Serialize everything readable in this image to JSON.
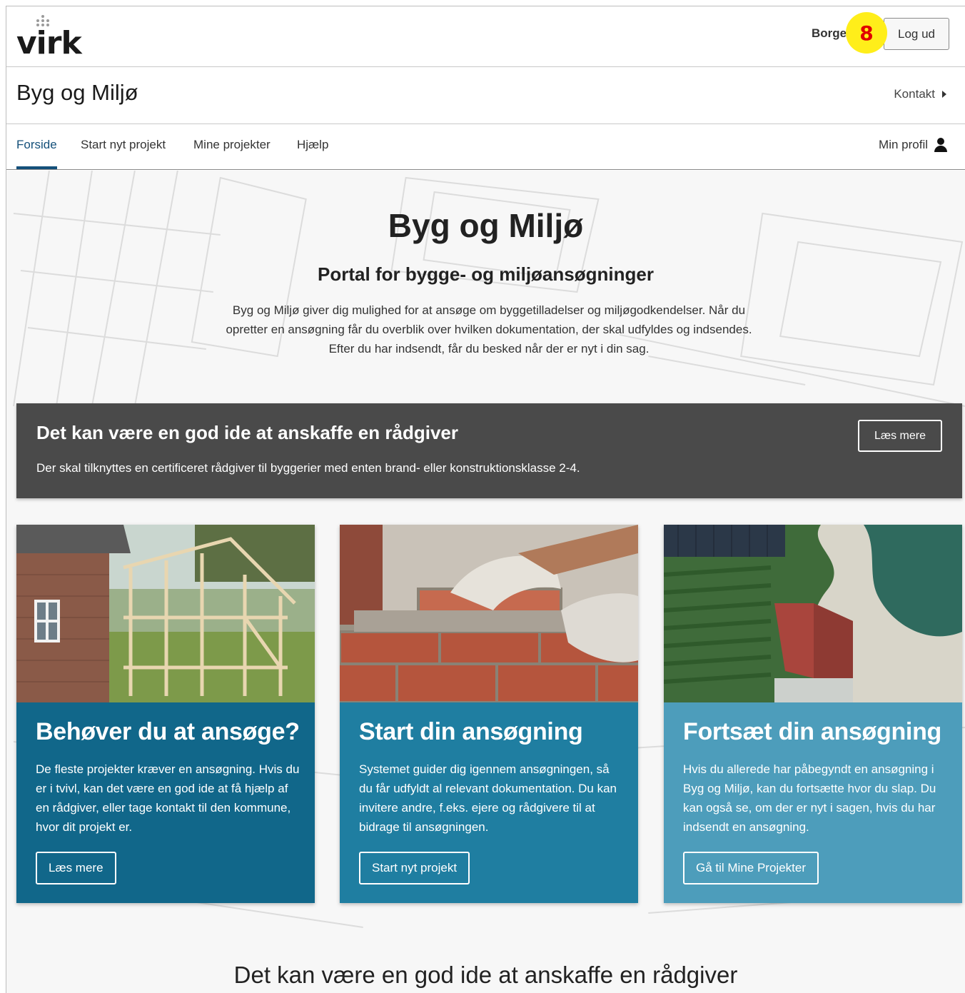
{
  "header": {
    "logo_text": "virk",
    "user_name": "Borge",
    "badge_number": "8",
    "logout_label": "Log ud"
  },
  "titlebar": {
    "site_title": "Byg og Miljø",
    "contact_label": "Kontakt"
  },
  "nav": {
    "items": [
      {
        "label": "Forside",
        "active": true
      },
      {
        "label": "Start nyt projekt",
        "active": false
      },
      {
        "label": "Mine projekter",
        "active": false
      },
      {
        "label": "Hjælp",
        "active": false
      }
    ],
    "profile_label": "Min profil"
  },
  "hero": {
    "title": "Byg og Miljø",
    "subtitle": "Portal for bygge- og miljøansøgninger",
    "description": "Byg og Miljø giver dig mulighed for at ansøge om byggetilladelser og miljøgodkendelser. Når du opretter en ansøgning får du overblik over hvilken dokumentation, der skal udfyldes og indsendes. Efter du har indsendt, får du besked når der er nyt i din sag."
  },
  "banner": {
    "title": "Det kan være en god ide at anskaffe en rådgiver",
    "text": "Der skal tilknyttes en certificeret rådgiver til byggerier med enten brand- eller konstruktionsklasse 2-4.",
    "button_label": "Læs mere"
  },
  "cards": [
    {
      "title": "Behøver du at ansøge?",
      "text": "De fleste projekter kræver en ansøgning. Hvis du er i tvivl, kan det være en god ide at få hjælp af en rådgiver, eller tage kontakt til den kommune, hvor dit projekt er.",
      "button_label": "Læs mere",
      "color": "#11678a"
    },
    {
      "title": "Start din ansøgning",
      "text": "Systemet guider dig igennem ansøgningen, så du får udfyldt al relevant dokumentation. Du kan invitere andre, f.eks. ejere og rådgivere til at bidrage til ansøgningen.",
      "button_label": "Start nyt projekt",
      "color": "#1f7ea1"
    },
    {
      "title": "Fortsæt din ansøgning",
      "text": "Hvis du allerede har påbegyndt en ansøgning i Byg og Miljø, kan du fortsætte hvor du slap. Du kan også se, om der er nyt i sagen, hvis du har indsendt en ansøgning.",
      "button_label": "Gå til Mine Projekter",
      "color": "#4d9dbb"
    }
  ],
  "bottom_heading": "Det kan være en god ide at anskaffe en rådgiver",
  "colors": {
    "active_nav": "#14507a",
    "banner_bg": "#4a4a4a",
    "badge_bg": "#ffee1a",
    "badge_text": "#e00000"
  }
}
